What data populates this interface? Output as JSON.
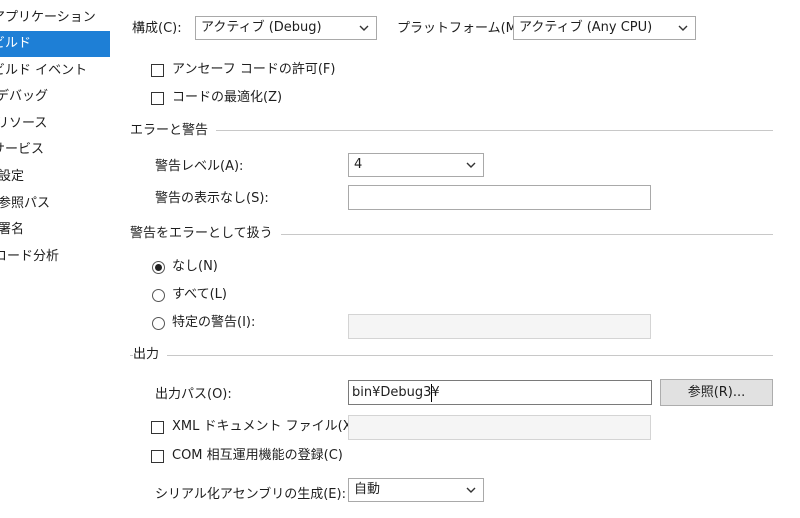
{
  "sidebar": {
    "items": [
      {
        "label": "アプリケーション"
      },
      {
        "label": "ビルド",
        "active": true
      },
      {
        "label": "ビルド イベント"
      },
      {
        "label": "デバッグ"
      },
      {
        "label": "リソース"
      },
      {
        "label": "サービス"
      },
      {
        "label": "設定"
      },
      {
        "label": "参照パス"
      },
      {
        "label": "署名"
      },
      {
        "label": "コード分析"
      }
    ]
  },
  "top": {
    "config_label": "構成(C):",
    "config_value": "アクティブ (Debug)",
    "platform_label": "プラットフォーム(M):",
    "platform_value": "アクティブ (Any CPU)"
  },
  "general": {
    "unsafe_label": "アンセーフ コードの許可(F)",
    "unsafe_checked": false,
    "optimize_label": "コードの最適化(Z)",
    "optimize_checked": false
  },
  "errors_warnings": {
    "title": "エラーと警告",
    "level_label": "警告レベル(A):",
    "level_value": "4",
    "suppress_label": "警告の表示なし(S):",
    "suppress_value": ""
  },
  "treat_warnings": {
    "title": "警告をエラーとして扱う",
    "none_label": "なし(N)",
    "all_label": "すべて(L)",
    "specific_label": "特定の警告(I):",
    "specific_value": "",
    "selected": "none"
  },
  "output": {
    "title": "出力",
    "path_label": "出力パス(O):",
    "path_value": "bin¥Debug3¥",
    "browse_label": "参照(R)...",
    "xml_label": "XML ドキュメント ファイル(X):",
    "xml_checked": false,
    "xml_value": "",
    "com_label": "COM 相互運用機能の登録(C)",
    "com_checked": false,
    "serialization_label": "シリアル化アセンブリの生成(E):",
    "serialization_value": "自動"
  },
  "colors": {
    "accent": "#1e7fd6"
  }
}
